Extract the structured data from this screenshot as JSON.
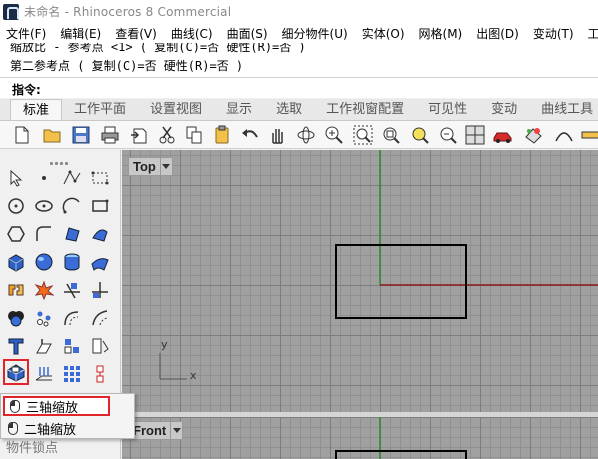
{
  "window": {
    "title": "未命名 - Rhinoceros 8 Commercial",
    "logo_icon": "rhino-logo-icon"
  },
  "menubar": {
    "items": [
      "文件(F)",
      "编辑(E)",
      "查看(V)",
      "曲线(C)",
      "曲面(S)",
      "细分物件(U)",
      "实体(O)",
      "网格(M)",
      "出图(D)",
      "变动(T)",
      "工具"
    ]
  },
  "command_history": {
    "line1": "缩放比 - 参考点 <1> ( 复制(C)=否  硬性(R)=否 )",
    "line2": "第二参考点 ( 复制(C)=否  硬性(R)=否 )",
    "prompt": "指令:",
    "input_value": ""
  },
  "toolbar_tabs": {
    "active": "标准",
    "items": [
      "标准",
      "工作平面",
      "设置视图",
      "显示",
      "选取",
      "工作视窗配置",
      "可见性",
      "变动",
      "曲线工具",
      "曲"
    ]
  },
  "toolbar_icons": [
    "new-file-icon",
    "open-folder-icon",
    "save-icon",
    "print-icon",
    "import-icon",
    "cut-icon",
    "copy-icon",
    "paste-icon",
    "undo-icon",
    "pan-hand-icon",
    "rotate-view-icon",
    "zoom-dynamic-icon",
    "zoom-window-icon",
    "zoom-extents-icon",
    "zoom-selected-icon",
    "undo-view-icon",
    "four-viewports-icon",
    "car-render-icon",
    "material-icon",
    "curve-icon"
  ],
  "sidebar_icons": [
    "select-arrow-icon",
    "point-icon",
    "polyline-icon",
    "rectangle-curve-icon",
    "circle-icon",
    "ellipse-icon",
    "arc-icon",
    "rectangle-icon",
    "polygon-icon",
    "fillet-curve-icon",
    "surface-from-points-icon",
    "revolve-surface-icon",
    "box-solid-icon",
    "sphere-icon",
    "cylinder-icon",
    "mesh-surface-icon",
    "join-icon",
    "explode-icon",
    "trim-icon",
    "split-icon",
    "boolean-union-icon",
    "array-icon",
    "offset-icon",
    "fillet-edge-icon",
    "text-icon",
    "extrude-icon",
    "group-icon",
    "dimension-icon",
    "scale-3d-icon",
    "move-up-icon",
    "grid-array-icon",
    "gumball-icon"
  ],
  "viewports": {
    "top_label": "Top",
    "front_label": "Front",
    "axis_x": "x",
    "axis_y": "y"
  },
  "popup": {
    "items": [
      "三轴缩放",
      "二轴缩放"
    ],
    "selected": "三轴缩放"
  },
  "panel_label_below": "物件锁点",
  "colors": {
    "viewport_bg": "#a0a0a0",
    "grid_major": "#7d7d7d",
    "x_axis": "#8b1a1a",
    "y_axis": "#2e8b2e",
    "highlight": "#e0262b"
  }
}
